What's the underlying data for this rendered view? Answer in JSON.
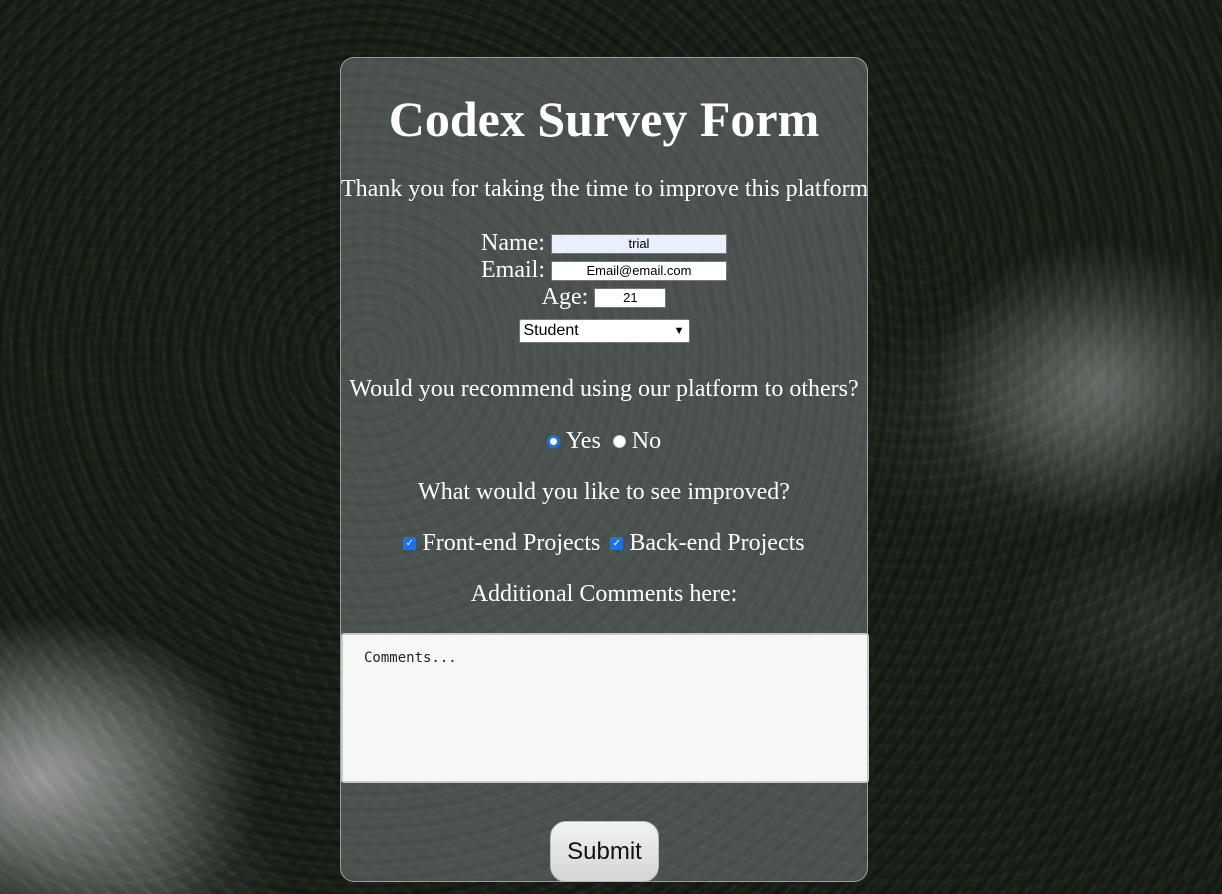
{
  "form": {
    "title": "Codex Survey Form",
    "subtitle": "Thank you for taking the time to improve this platform",
    "name_label": "Name:",
    "name_value": "trial",
    "email_label": "Email:",
    "email_value": "Email@email.com",
    "age_label": "Age:",
    "age_value": "21",
    "role_selected": "Student",
    "recommend_question": "Would you recommend using our platform to others?",
    "recommend_options": [
      {
        "label": "Yes",
        "selected": true
      },
      {
        "label": "No",
        "selected": false
      }
    ],
    "improve_question": "What would you like to see improved?",
    "improve_options": [
      {
        "label": "Front-end Projects",
        "checked": true
      },
      {
        "label": "Back-end Projects",
        "checked": true
      }
    ],
    "comments_label": "Additional Comments here:",
    "comments_placeholder": "Comments...",
    "submit_label": "Submit"
  },
  "colors": {
    "accent": "#1a73e8",
    "autofill": "#e8f0fe",
    "card_text": "#ffffff"
  },
  "icons": {
    "select_arrow": "chevron-down-icon",
    "checkbox_mark": "checkmark-icon"
  }
}
